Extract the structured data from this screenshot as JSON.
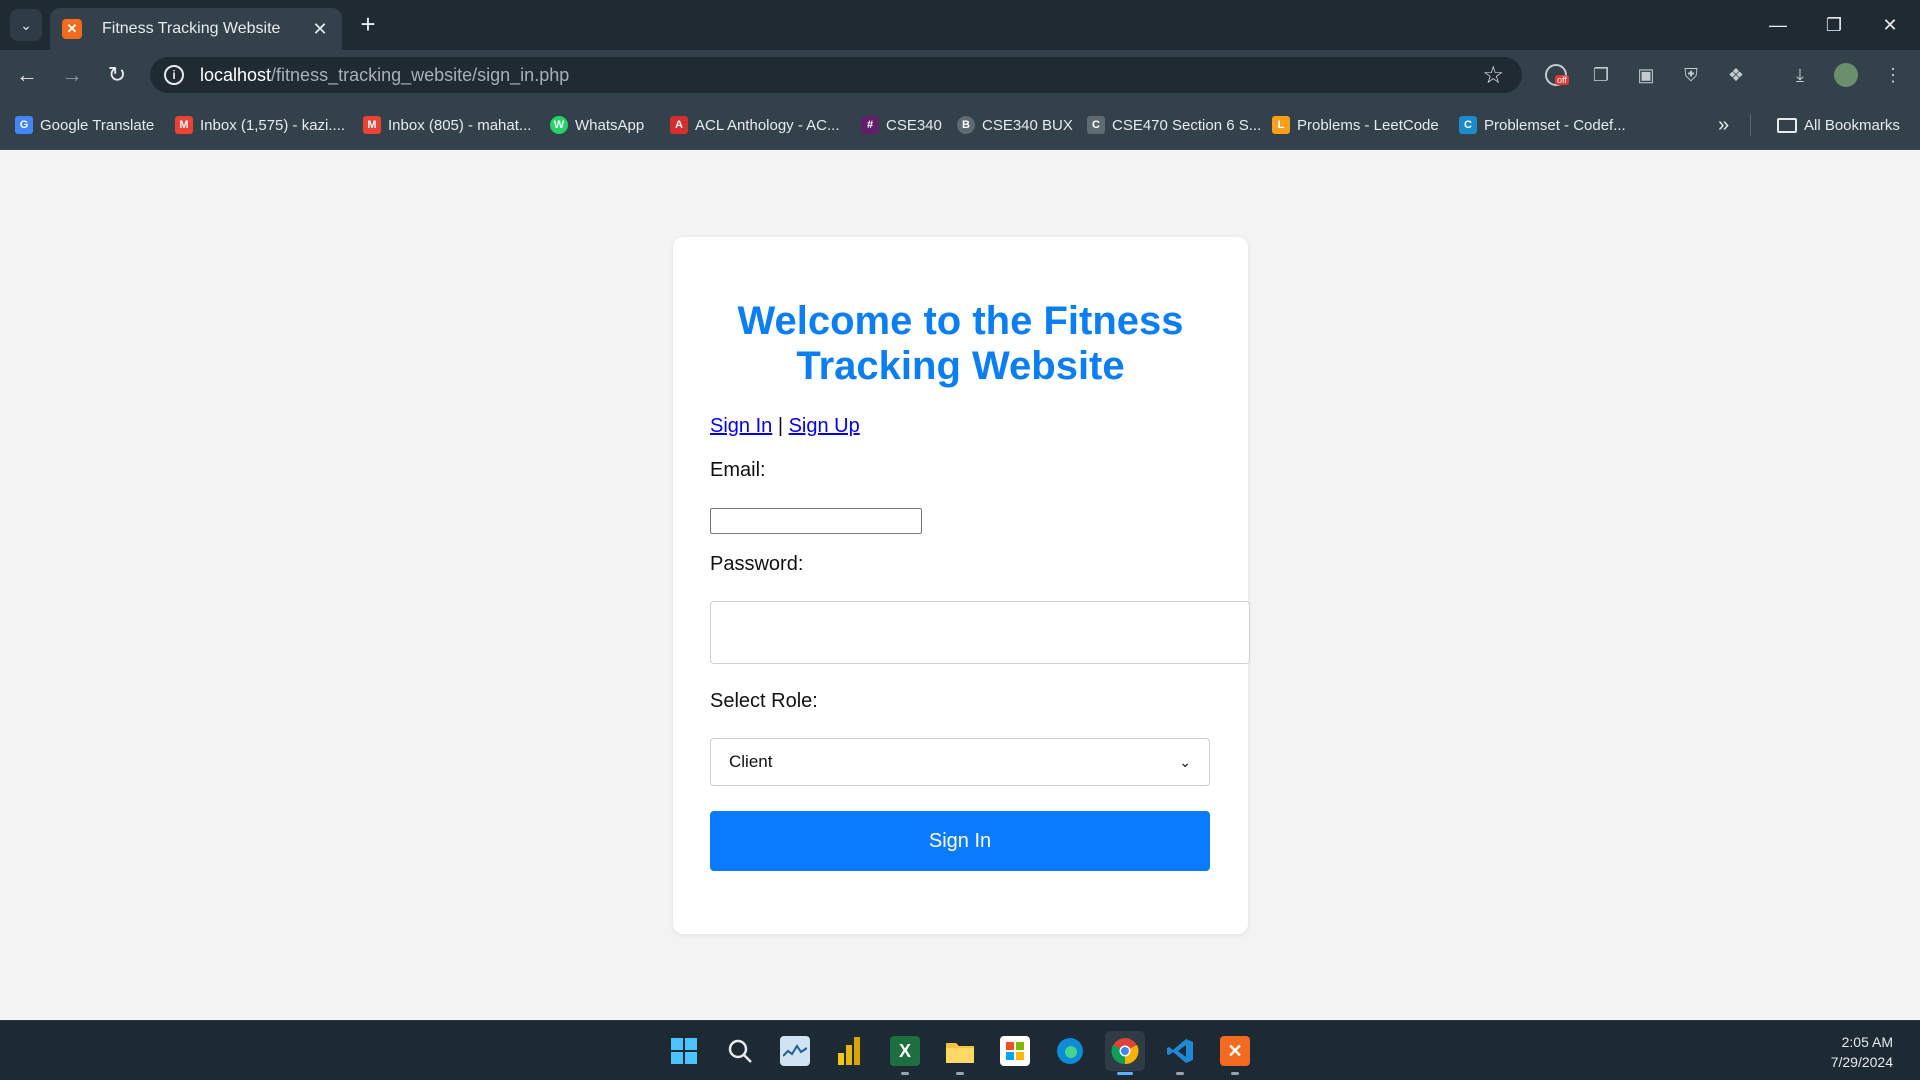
{
  "browser": {
    "tab_title": "Fitness Tracking Website",
    "tab_favicon": "xampp-icon",
    "url_host": "localhost",
    "url_path": "/fitness_tracking_website/sign_in.php",
    "accent": "#33414b"
  },
  "bookmarks": [
    {
      "label": "Google Translate",
      "icon": "google-translate-icon",
      "color": "#4285f4",
      "glyph": "G"
    },
    {
      "label": "Inbox (1,575) - kazi....",
      "icon": "gmail-icon",
      "color": "#ea4335",
      "glyph": "M"
    },
    {
      "label": "Inbox (805) - mahat...",
      "icon": "gmail-icon",
      "color": "#ea4335",
      "glyph": "M"
    },
    {
      "label": "WhatsApp",
      "icon": "whatsapp-icon",
      "color": "#25d366",
      "glyph": "W"
    },
    {
      "label": "ACL Anthology - AC...",
      "icon": "acl-icon",
      "color": "#d32f2f",
      "glyph": "A"
    },
    {
      "label": "CSE340",
      "icon": "slack-icon",
      "color": "#611f69",
      "glyph": "#"
    },
    {
      "label": "CSE340 BUX",
      "icon": "bux-icon",
      "color": "#5f6b73",
      "glyph": "B"
    },
    {
      "label": "CSE470 Section 6 S...",
      "icon": "contact-card-icon",
      "color": "#5f6b73",
      "glyph": "C"
    },
    {
      "label": "Problems - LeetCode",
      "icon": "leetcode-icon",
      "color": "#f89f1b",
      "glyph": "L"
    },
    {
      "label": "Problemset - Codef...",
      "icon": "codeforces-icon",
      "color": "#1f8acb",
      "glyph": "C"
    }
  ],
  "bookmarks_more": "»",
  "all_bookmarks": "All Bookmarks",
  "page": {
    "heading": "Welcome to the Fitness Tracking Website",
    "link_sign_in": "Sign In",
    "link_separator": " | ",
    "link_sign_up": "Sign Up",
    "email_label": "Email:",
    "email_value": "",
    "password_label": "Password:",
    "password_value": "",
    "role_label": "Select Role:",
    "role_selected": "Client",
    "submit_label": "Sign In",
    "heading_color": "#0a7ef2",
    "button_color": "#0a7bff"
  },
  "taskbar": {
    "time": "2:05 AM",
    "date": "7/29/2024",
    "apps": [
      {
        "name": "start-icon",
        "active": false
      },
      {
        "name": "search-icon",
        "active": false
      },
      {
        "name": "task-manager-icon",
        "active": false
      },
      {
        "name": "power-bi-icon",
        "active": false
      },
      {
        "name": "excel-icon",
        "active": false
      },
      {
        "name": "file-explorer-icon",
        "active": false
      },
      {
        "name": "microsoft-store-icon",
        "active": false
      },
      {
        "name": "edge-icon",
        "active": false
      },
      {
        "name": "chrome-icon",
        "active": true
      },
      {
        "name": "vscode-icon",
        "active": false
      },
      {
        "name": "xampp-icon",
        "active": false
      }
    ]
  }
}
